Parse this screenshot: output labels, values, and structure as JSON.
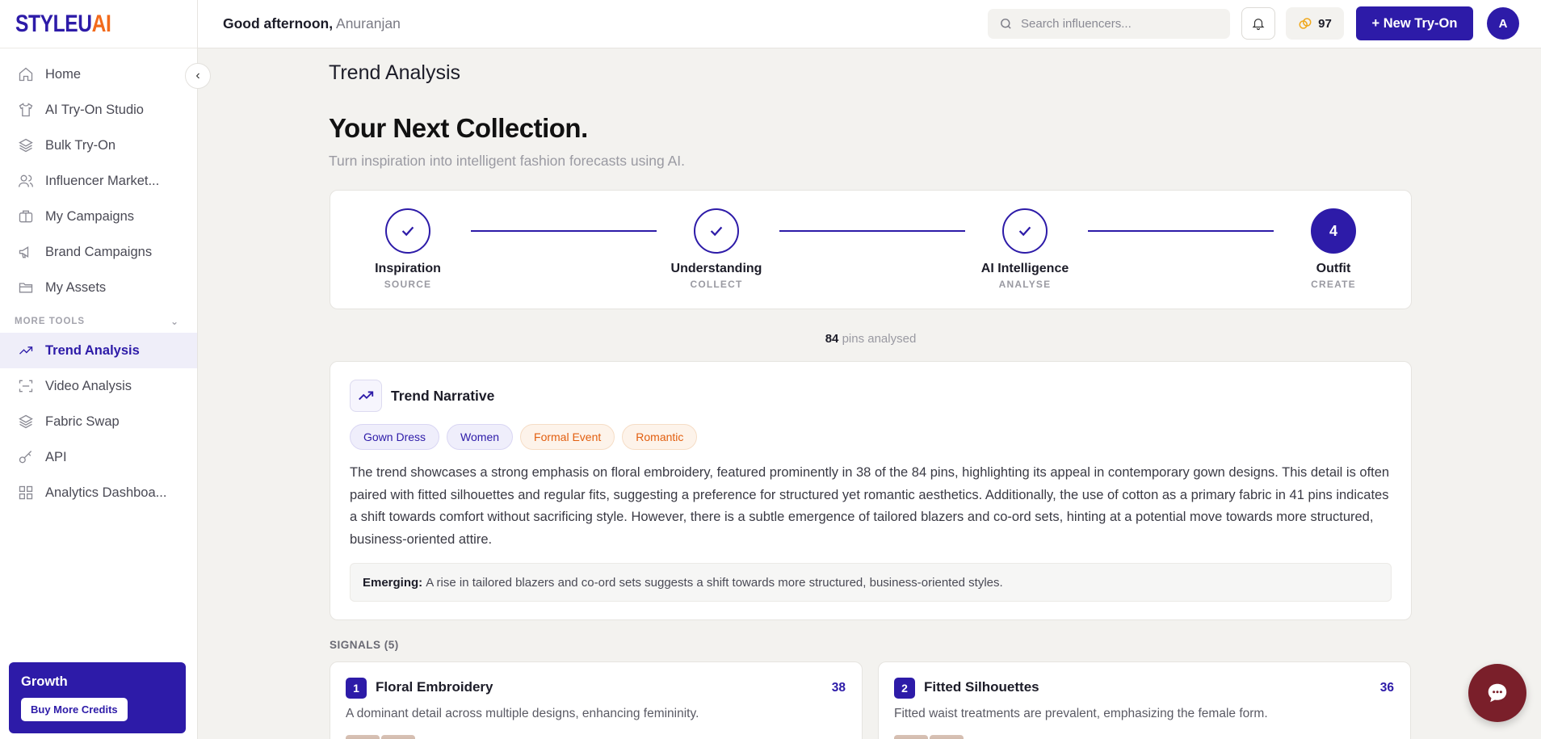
{
  "brand": {
    "part1": "STYLEU",
    "part2": "AI"
  },
  "sidebar": {
    "items": [
      {
        "label": "Home",
        "icon": "home-icon"
      },
      {
        "label": "AI Try-On Studio",
        "icon": "shirt-icon"
      },
      {
        "label": "Bulk Try-On",
        "icon": "layers-icon"
      },
      {
        "label": "Influencer Market...",
        "icon": "users-icon"
      },
      {
        "label": "My Campaigns",
        "icon": "briefcase-icon"
      },
      {
        "label": "Brand Campaigns",
        "icon": "megaphone-icon"
      },
      {
        "label": "My Assets",
        "icon": "folder-icon"
      }
    ],
    "more_tools_label": "MORE TOOLS",
    "more_items": [
      {
        "label": "Trend Analysis",
        "icon": "trending-up-icon",
        "active": true
      },
      {
        "label": "Video Analysis",
        "icon": "scan-icon"
      },
      {
        "label": "Fabric Swap",
        "icon": "layers-icon"
      },
      {
        "label": "API",
        "icon": "key-icon"
      },
      {
        "label": "Analytics Dashboa...",
        "icon": "grid-icon"
      }
    ],
    "growth": {
      "title": "Growth",
      "button": "Buy More Credits"
    }
  },
  "header": {
    "greeting": "Good afternoon,",
    "name": "Anuranjan",
    "search_placeholder": "Search influencers...",
    "credits": "97",
    "new_button": "+ New Try-On",
    "avatar_initial": "A"
  },
  "main": {
    "page_title": "Trend Analysis",
    "hero_title": "Your Next Collection.",
    "hero_subtitle": "Turn inspiration into intelligent fashion forecasts using AI.",
    "steps": [
      {
        "label": "Inspiration",
        "sub": "SOURCE",
        "done": true
      },
      {
        "label": "Understanding",
        "sub": "COLLECT",
        "done": true
      },
      {
        "label": "AI Intelligence",
        "sub": "ANALYSE",
        "done": true
      },
      {
        "label": "Outfit",
        "sub": "CREATE",
        "number": "4"
      }
    ],
    "pins_count": "84",
    "pins_label": "pins analysed",
    "narrative": {
      "title": "Trend Narrative",
      "tags": [
        "Gown Dress",
        "Women",
        "Formal Event",
        "Romantic"
      ],
      "body": "The trend showcases a strong emphasis on floral embroidery, featured prominently in 38 of the 84 pins, highlighting its appeal in contemporary gown designs. This detail is often paired with fitted silhouettes and regular fits, suggesting a preference for structured yet romantic aesthetics. Additionally, the use of cotton as a primary fabric in 41 pins indicates a shift towards comfort without sacrificing style. However, there is a subtle emergence of tailored blazers and co-ord sets, hinting at a potential move towards more structured, business-oriented attire.",
      "emerging_label": "Emerging:",
      "emerging_text": "A rise in tailored blazers and co-ord sets suggests a shift towards more structured, business-oriented styles."
    },
    "signals_label": "SIGNALS (5)",
    "signals": [
      {
        "rank": "1",
        "title": "Floral Embroidery",
        "count": "38",
        "desc": "A dominant detail across multiple designs, enhancing femininity."
      },
      {
        "rank": "2",
        "title": "Fitted Silhouettes",
        "count": "36",
        "desc": "Fitted waist treatments are prevalent, emphasizing the female form."
      }
    ]
  },
  "colors": {
    "primary": "#2d1ba8",
    "accent": "#f26a1b",
    "chat": "#7a1f2a"
  }
}
